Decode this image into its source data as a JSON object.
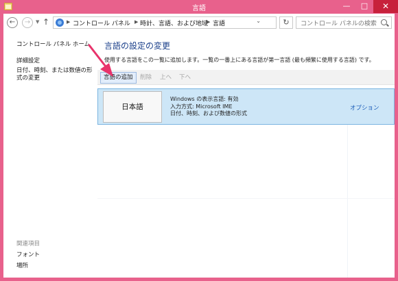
{
  "window": {
    "title": "言語"
  },
  "nav": {
    "breadcrumb": [
      "コントロール パネル",
      "時計、言語、および地域",
      "言語"
    ],
    "search_placeholder": "コントロール パネルの検索"
  },
  "sidebar": {
    "home": "コントロール パネル ホーム",
    "links": [
      "詳細設定",
      "日付、時刻、または数値の形式の変更"
    ],
    "related_title": "関連項目",
    "related": [
      "フォント",
      "場所"
    ]
  },
  "main": {
    "heading": "言語の設定の変更",
    "description": "使用する言語をこの一覧に追加します。一覧の一番上にある言語が第一言語 (最も頻繁に使用する言語) です。",
    "toolbar": {
      "add": "言語の追加",
      "remove": "削除",
      "up": "上へ",
      "down": "下へ"
    },
    "languages": [
      {
        "name": "日本語",
        "details": [
          "Windows の表示言語: 有効",
          "入力方式: Microsoft IME",
          "日付、時刻、および数値の形式"
        ],
        "options": "オプション"
      }
    ]
  },
  "colors": {
    "frame": "#e8618c",
    "close": "#c7213b",
    "selected_row": "#cde6f7",
    "heading": "#1a3f8a",
    "arrow": "#e8336b"
  }
}
